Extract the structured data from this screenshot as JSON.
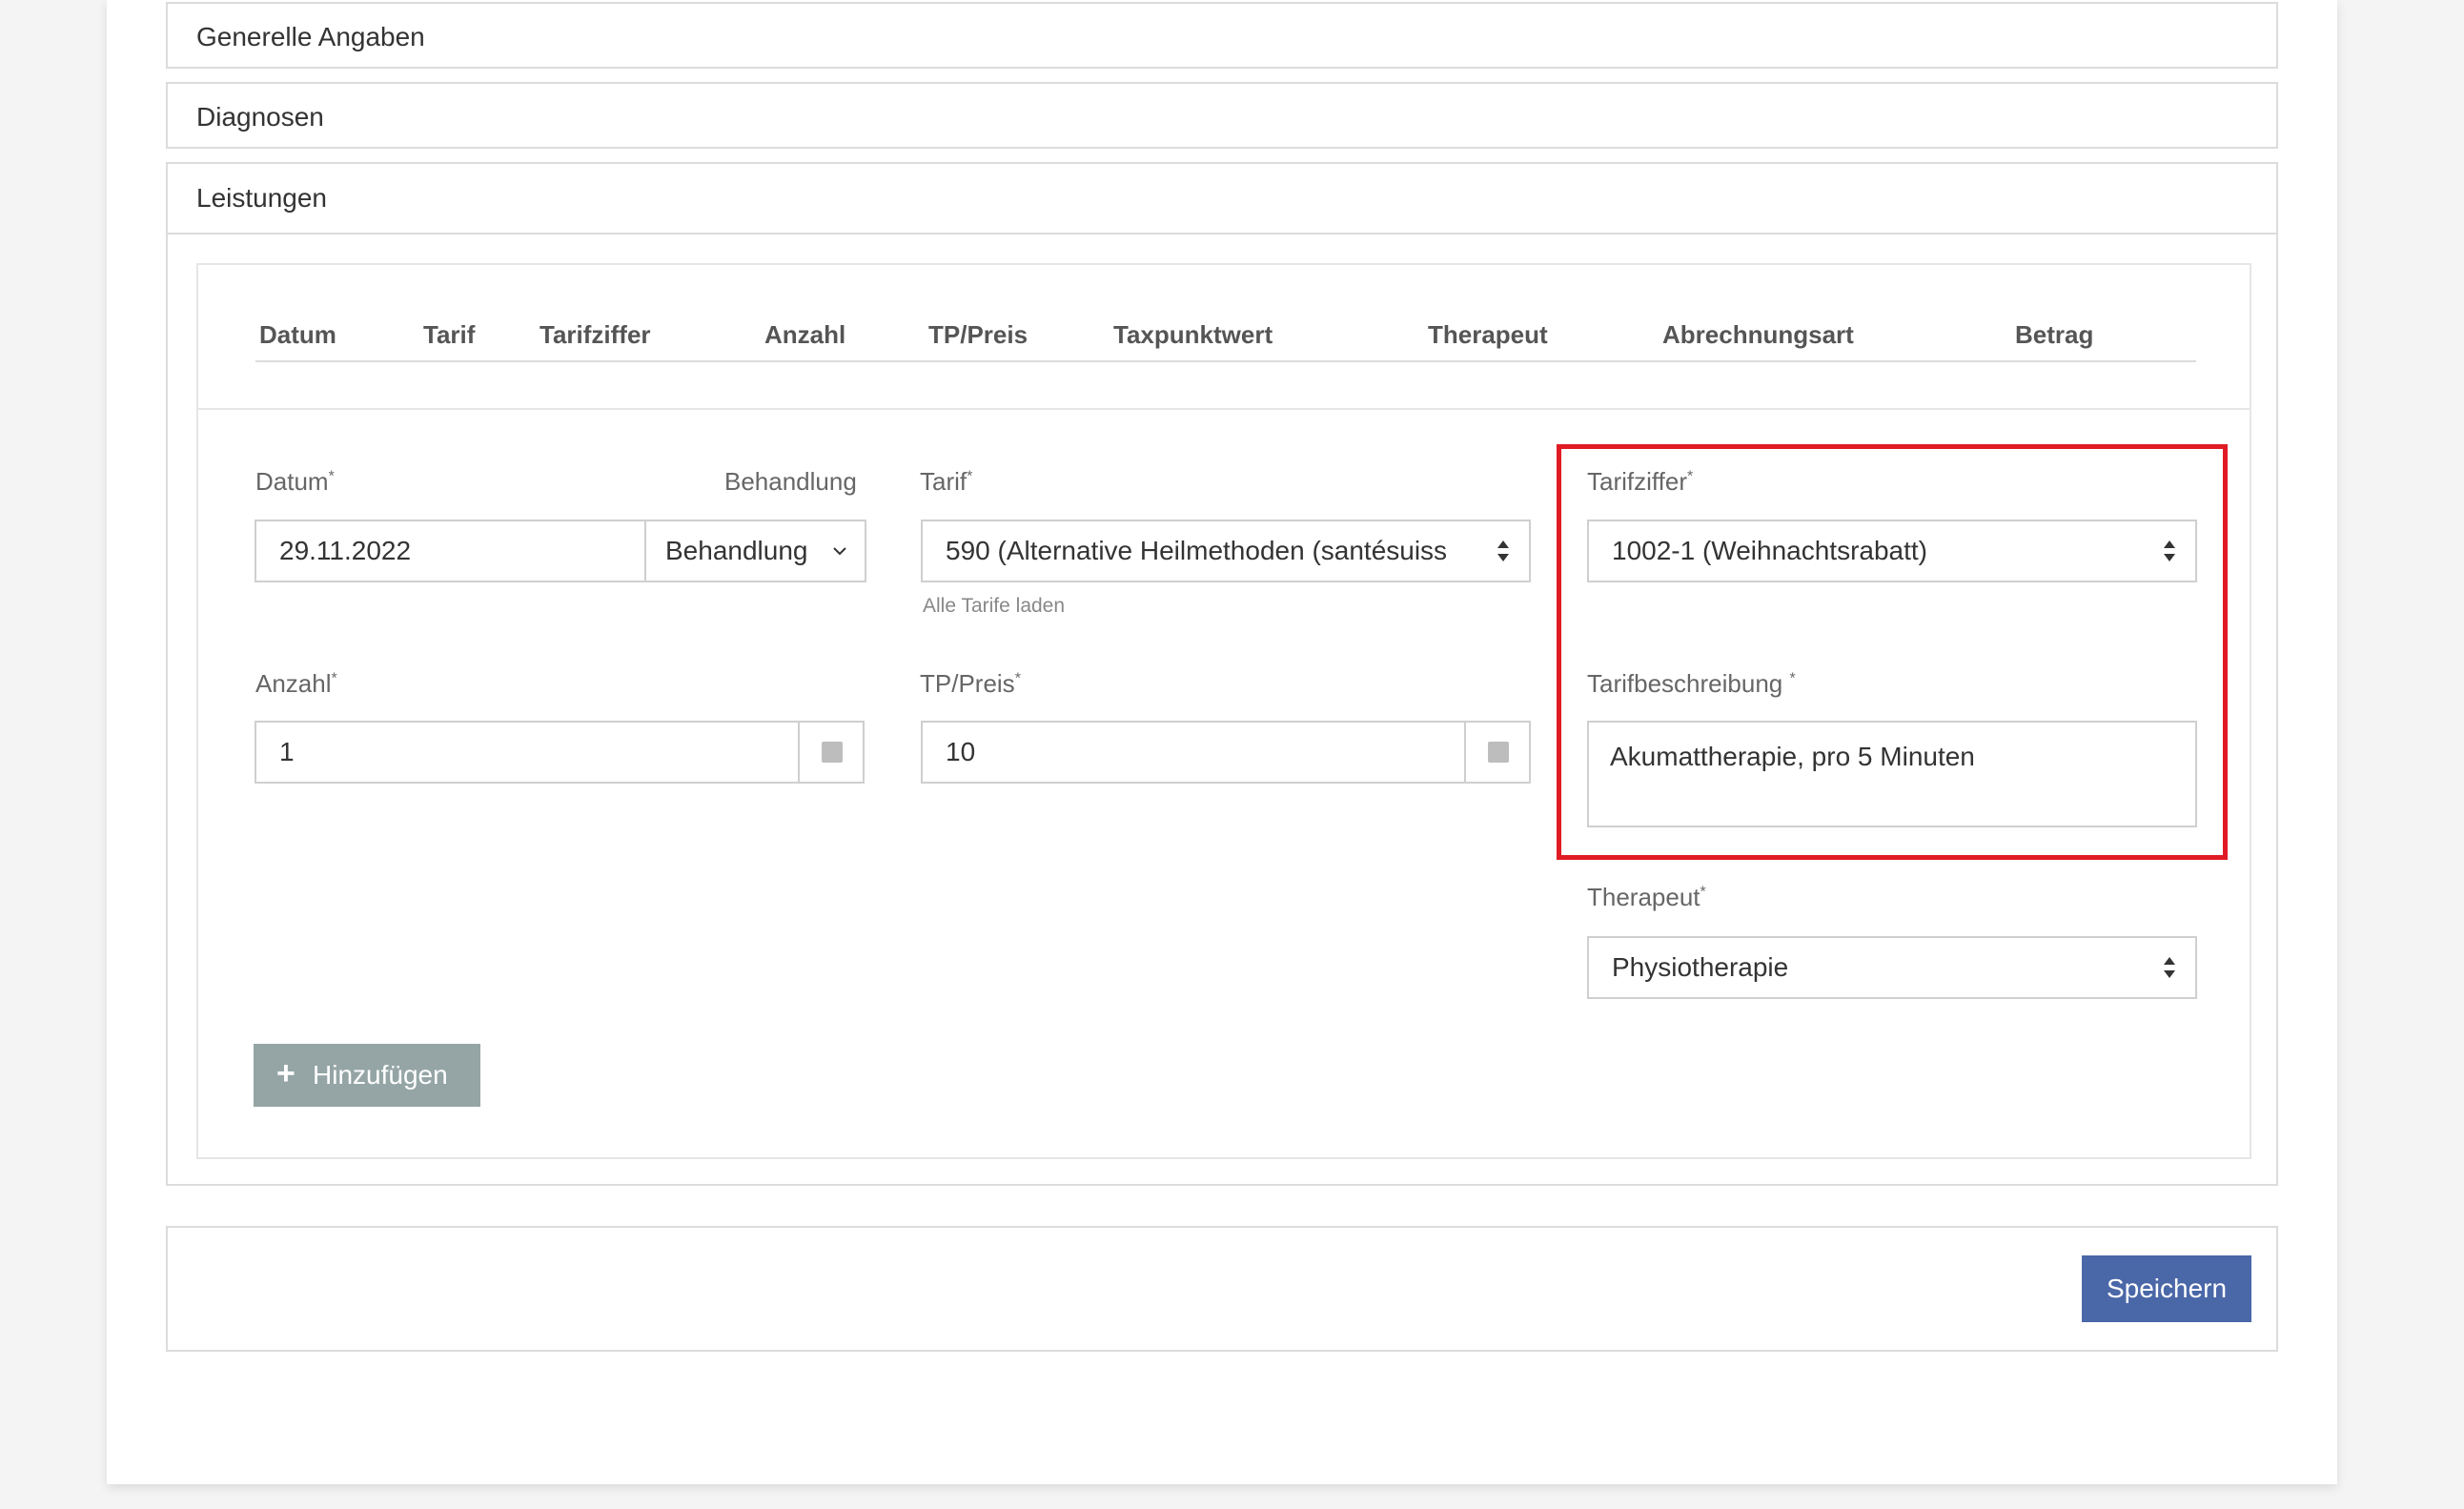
{
  "sections": {
    "generelle_angaben": "Generelle Angaben",
    "diagnosen": "Diagnosen",
    "leistungen": "Leistungen"
  },
  "table": {
    "columns": [
      "Datum",
      "Tarif",
      "Tarifziffer",
      "Anzahl",
      "TP/Preis",
      "Taxpunktwert",
      "Therapeut",
      "Abrechnungsart",
      "Betrag"
    ]
  },
  "form": {
    "datum_label": "Datum",
    "datum_value": "29.11.2022",
    "behandlung_label": "Behandlung",
    "behandlung_value": "Behandlung",
    "tarif_label": "Tarif",
    "tarif_value": "590 (Alternative Heilmethoden (santésuiss",
    "tarif_hint": "Alle Tarife laden",
    "tarifziffer_label": "Tarifziffer",
    "tarifziffer_value": "1002-1 (Weihnachtsrabatt)",
    "anzahl_label": "Anzahl",
    "anzahl_value": "1",
    "tp_preis_label": "TP/Preis",
    "tp_preis_value": "10",
    "tarifbeschreibung_label": "Tarifbeschreibung",
    "tarifbeschreibung_value": "Akumattherapie, pro 5 Minuten",
    "therapeut_label": "Therapeut",
    "therapeut_value": "Physiotherapie",
    "required_mark": "*"
  },
  "buttons": {
    "add": "Hinzufügen",
    "save": "Speichern"
  },
  "colors": {
    "save_button": "#4a67a8",
    "add_button": "#95a5a6",
    "highlight": "#e01b24"
  },
  "icons": {
    "add": "plus-icon",
    "behandlung": "chevron-down-icon",
    "select": "sort-arrows-icon"
  }
}
